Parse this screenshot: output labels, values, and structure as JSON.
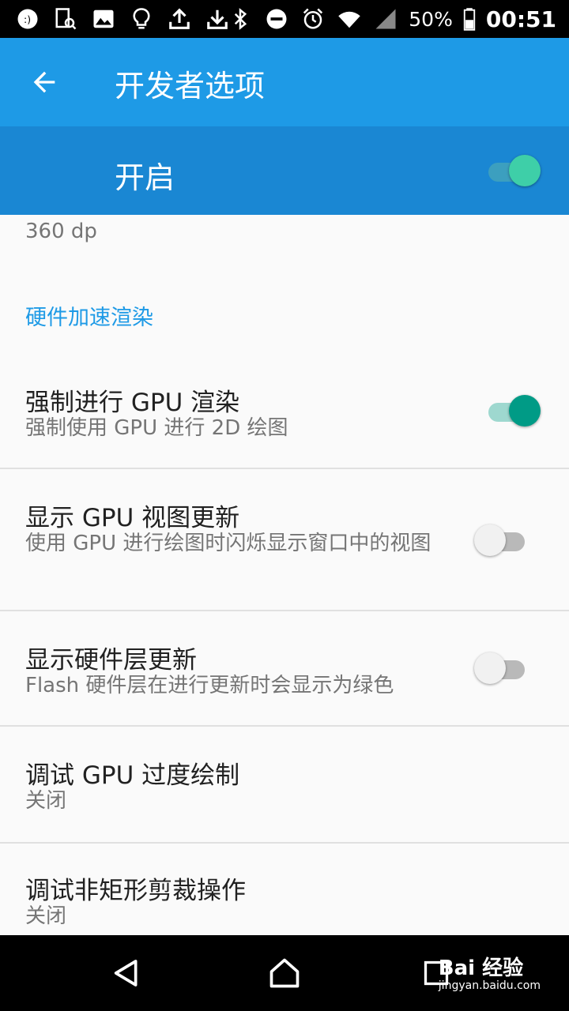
{
  "status_bar": {
    "battery": "50%",
    "time": "00:51",
    "icons_left": [
      "assistant-icon",
      "device-search-icon",
      "image-icon",
      "lightbulb-icon",
      "upload-icon",
      "download-icon"
    ],
    "icons_right": [
      "bluetooth-icon",
      "do-not-disturb-icon",
      "alarm-icon",
      "wifi-icon",
      "signal-icon",
      "battery-icon"
    ]
  },
  "appbar": {
    "title": "开发者选项",
    "back_icon": "arrow-back-icon"
  },
  "master": {
    "label": "开启",
    "state": "on"
  },
  "content": {
    "dp_value": "360 dp",
    "section_header": "硬件加速渲染",
    "items": [
      {
        "title": "强制进行 GPU 渲染",
        "summary": "强制使用 GPU 进行 2D 绘图",
        "switch": "on"
      },
      {
        "title": "显示 GPU 视图更新",
        "summary": "使用 GPU 进行绘图时闪烁显示窗口中的视图",
        "switch": "off"
      },
      {
        "title": "显示硬件层更新",
        "summary": "Flash 硬件层在进行更新时会显示为绿色",
        "switch": "off"
      },
      {
        "title": "调试 GPU 过度绘制",
        "summary": "关闭"
      },
      {
        "title": "调试非矩形剪裁操作",
        "summary": "关闭"
      }
    ]
  },
  "navbar": {
    "icons": [
      "back-triangle-icon",
      "home-icon",
      "recents-icon"
    ],
    "watermark_top": "Bai 经验",
    "watermark_bottom": "jingyan.baidu.com"
  },
  "colors": {
    "appbar": "#1e9ae6",
    "masterbar": "#1a87d3",
    "accent": "#009b86",
    "section": "#1e9ae6"
  }
}
